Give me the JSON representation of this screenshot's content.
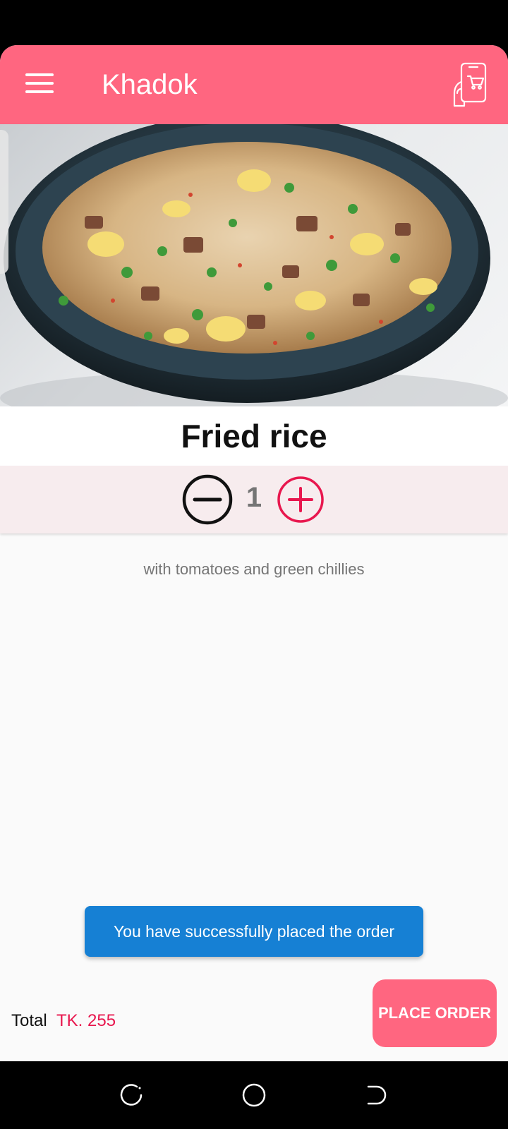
{
  "app": {
    "title": "Khadok"
  },
  "icons": {
    "menu": "hamburger-menu-icon",
    "cart": "mobile-shopping-cart-icon",
    "minus": "minus-circle-icon",
    "plus": "plus-circle-icon"
  },
  "food": {
    "name": "Fried rice",
    "quantity": "1",
    "description": "with tomatoes and green chillies"
  },
  "toast": {
    "message": "You have successfully placed the order"
  },
  "footer": {
    "total_label": "Total",
    "currency": "TK.",
    "total_value": "255",
    "place_order_label": "PLACE ORDER"
  },
  "colors": {
    "primary": "#ff6680",
    "accent": "#e8174e",
    "toast": "#1680d4",
    "quantity_background": "#f7ecee"
  }
}
